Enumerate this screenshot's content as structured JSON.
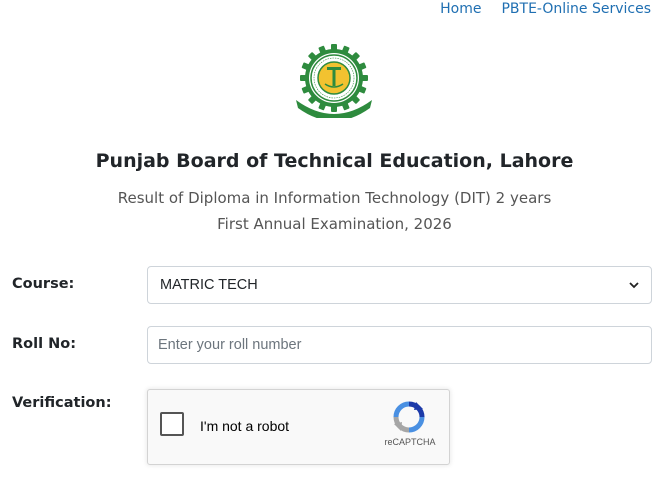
{
  "nav": {
    "home": "Home",
    "services": "PBTE-Online Services"
  },
  "header": {
    "title": "Punjab Board of Technical Education, Lahore",
    "subtitle_line1": "Result of Diploma in Information Technology (DIT) 2 years",
    "subtitle_line2": "First Annual Examination, 2026"
  },
  "form": {
    "course_label": "Course:",
    "course_value": "MATRIC TECH",
    "rollno_label": "Roll No:",
    "rollno_placeholder": "Enter your roll number",
    "rollno_value": "",
    "verification_label": "Verification:"
  },
  "captcha": {
    "checkbox_text": "I'm not a robot",
    "brand": "reCAPTCHA",
    "checked": false
  },
  "colors": {
    "link": "#1f6fb2",
    "logo_green": "#2e8b3e",
    "logo_yellow": "#f2c230"
  },
  "icons": {
    "logo": "pbte-emblem",
    "select_arrow": "chevron-down-icon",
    "recaptcha": "recaptcha-icon"
  }
}
